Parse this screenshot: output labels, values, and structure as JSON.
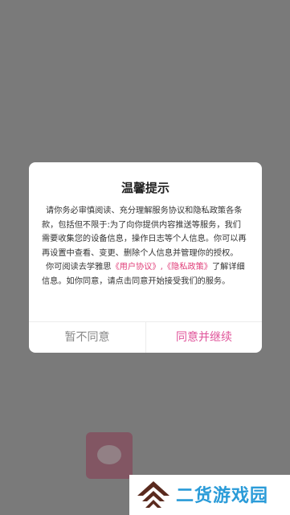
{
  "splash": {
    "app_name": "",
    "slogan": ""
  },
  "dialog": {
    "title": "温馨提示",
    "paragraph1": "请你务必审慎阅读、充分理解服务协议和隐私政策各条款，包括但不限于:为了向你提供内容推送等服务，我们需要收集您的设备信息，操作日志等个人信息。你可以再再设置中查看、变更、删除个人信息并管理你的授权。",
    "paragraph2_prefix": "你可阅读去学雅思",
    "link_user_agreement": "《用户协议》",
    "link_separator": ",",
    "link_privacy_policy": "《隐私政策》",
    "paragraph2_suffix": "了解详细信息。如你同意，请点击同意开始接受我们的服务。",
    "decline_label": "暂不同意",
    "accept_label": "同意并继续"
  },
  "watermark": {
    "text": "二货游戏园",
    "icon": "house-logo-icon"
  },
  "colors": {
    "overlay": "#7a7a7a",
    "accent": "#e0549a",
    "link": "#e03c78",
    "watermark_text": "#2a9bd8",
    "watermark_logo": "#5a2a1e"
  }
}
